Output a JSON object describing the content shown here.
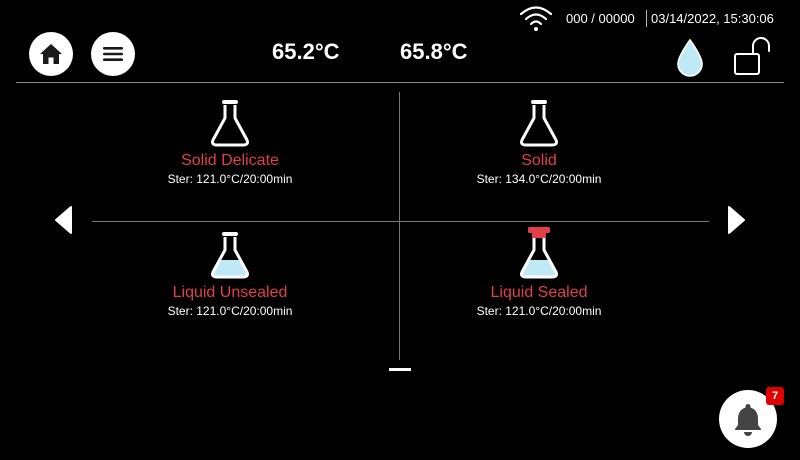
{
  "status": {
    "counter": "000 / 00000",
    "datetime": "03/14/2022, 15:30:06"
  },
  "temperatures": {
    "temp_1": "65.2°C",
    "temp_2": "65.8°C"
  },
  "programs": [
    {
      "name": "Solid Delicate",
      "ster": "Ster: 121.0°C/20:00min",
      "icon": "flask-empty-icon"
    },
    {
      "name": "Solid",
      "ster": "Ster: 134.0°C/20:00min",
      "icon": "flask-empty-icon"
    },
    {
      "name": "Liquid Unsealed",
      "ster": "Ster: 121.0°C/20:00min",
      "icon": "flask-liquid-icon"
    },
    {
      "name": "Liquid Sealed",
      "ster": "Ster: 121.0°C/20:00min",
      "icon": "flask-liquid-sealed-icon"
    }
  ],
  "notifications": {
    "count": "7"
  },
  "colors": {
    "accent": "#e0404a",
    "liquid": "#bfe9f6",
    "badge": "#e00000",
    "background": "#000000"
  }
}
